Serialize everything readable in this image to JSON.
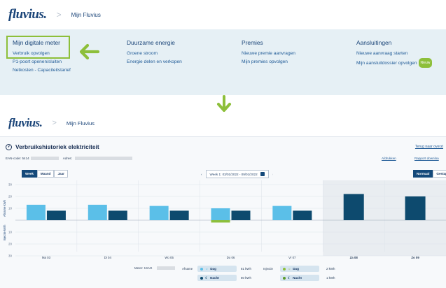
{
  "brand": {
    "logo": "fluvius."
  },
  "breadcrumb_top": {
    "sep": ">",
    "item": "Mijn Fluvius"
  },
  "menu": {
    "cols": [
      {
        "title": "Mijn digitale meter",
        "links": [
          "Verbruik opvolgen",
          "P1-poort openen/sluiten",
          "Netkosten - Capaciteitstarief"
        ]
      },
      {
        "title": "Duurzame energie",
        "links": [
          "Groene stroom",
          "Energie delen en verkopen"
        ]
      },
      {
        "title": "Premies",
        "links": [
          "Nieuwe premie aanvragen",
          "Mijn premies opvolgen"
        ]
      },
      {
        "title": "Aansluitingen",
        "links": [
          "Nieuwe aanvraag starten",
          "Mijn aansluitdossier opvolgen"
        ],
        "badge": "Nieuw"
      }
    ]
  },
  "colors": {
    "accent_green": "#8dbf3a",
    "navy": "#14497a",
    "light_blue": "#5bbfe8",
    "dark_blue": "#0d4a6e"
  },
  "breadcrumb_bottom": {
    "sep": ">",
    "item": "Mijn Fluvius"
  },
  "page": {
    "title": "Verbruikshistoriek elektriciteit",
    "back_link": "Terug naar overzi",
    "ean_label": "EAN-code: 5414",
    "address_label": "Adres:",
    "print_link": "Afdrukken",
    "report_link": "Rapport downloa"
  },
  "controls": {
    "period_tabs": [
      "Week",
      "Maand",
      "Jaar"
    ],
    "week_label": "Week 1: 03/01/2022 - 09/01/2022",
    "view_tabs": [
      "Normaal",
      "Gestapel"
    ]
  },
  "chart_data": {
    "type": "bar",
    "categories": [
      "Ma 03",
      "Di 04",
      "Wo 05",
      "Do 06",
      "Vr 07",
      "Za 08",
      "Zo 09"
    ],
    "ylabel_top": "Afname kWh",
    "ylabel_bottom": "Injectie kWh",
    "y_ticks_top": [
      "30",
      "20",
      "10"
    ],
    "y_ticks_bottom": [
      "10",
      "20",
      "30"
    ],
    "ylim": [
      -30,
      30
    ],
    "series": [
      {
        "name": "Dag",
        "values": [
          13,
          13,
          12,
          10,
          12,
          0,
          0
        ]
      },
      {
        "name": "Nacht",
        "values": [
          8,
          8,
          8,
          8,
          8,
          22,
          20
        ]
      },
      {
        "name": "Injectie Dag",
        "values": [
          0,
          0,
          0,
          -2,
          0,
          0,
          0
        ]
      }
    ],
    "weekend_from_index": 5
  },
  "legend": {
    "meter_label": "Meter: 1SAG",
    "afname_label": "Afname",
    "injectie_label": "Injectie",
    "dag": "Dag",
    "nacht": "Nacht",
    "afname_dag_value": "81 kWh",
    "afname_nacht_value": "80 kWh",
    "injectie_dag_value": "2 kWh",
    "injectie_nacht_value": "1 kWh"
  }
}
